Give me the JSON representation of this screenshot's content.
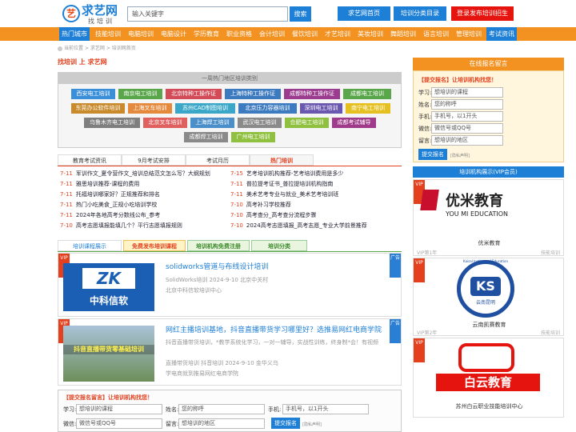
{
  "header": {
    "logo_char": "艺",
    "logo_name": "求艺网",
    "logo_sub": "找培训",
    "search_placeholder": "输入关键字",
    "search_label": "搜索",
    "btn_home": "求艺网首页",
    "btn_catalog": "培训分类目录",
    "btn_login": "登录发布培训招生"
  },
  "nav": [
    "热门城市",
    "技能培训",
    "电脑培训",
    "电脑设计",
    "学历教育",
    "职业资格",
    "会计培训",
    "餐饮培训",
    "才艺培训",
    "美妆培训",
    "舞蹈培训",
    "语言培训",
    "管理培训",
    "考试资讯"
  ],
  "breadcrumb": {
    "home": "当前位置",
    "sep1": ">",
    "link": "求艺网",
    "sep2": ">",
    "current": "培训网首页"
  },
  "main_title": "找培训 上 求艺网",
  "hot": {
    "heading": "一周热门地区培训类别",
    "tags": [
      "西安电工培训",
      "南京电工培训",
      "北京特种工操作证",
      "上海特种工操作证",
      "成都特种工操作证",
      "成都电工培训",
      "东莞办公软件培训",
      "上海叉车培训",
      "苏州CAD制图培训",
      "北京压力容器培训",
      "深圳电工培训",
      "南宁电工培训",
      "乌鲁木齐电工培训",
      "北京叉车培训",
      "上海焊工培训",
      "武汉电工培训",
      "合肥电工培训",
      "成都考试辅导",
      "成都焊工培训",
      "广州电工培训"
    ]
  },
  "tabs1": [
    "教育考试资讯",
    "9月考试安排",
    "考试月历",
    "热门培训"
  ],
  "news_left": [
    {
      "date": "7-11",
      "title": "军训作文_夏令营作文_培训总结范文怎么写？大纲规划"
    },
    {
      "date": "7-11",
      "title": "雅思培训推荐-课程的费用"
    },
    {
      "date": "7-11",
      "title": "托福培训哪家好？正规推荐和排名"
    },
    {
      "date": "7-11",
      "title": "热门小吃美食_正规小吃培训学校"
    },
    {
      "date": "7-11",
      "title": "2024年各地高考分数线公布_参考"
    },
    {
      "date": "7-10",
      "title": "高考志愿填报能填几个？平行志愿填报规则"
    }
  ],
  "news_right": [
    {
      "date": "7-15",
      "title": "艺考培训机构推荐-艺考培训费用是多少"
    },
    {
      "date": "7-11",
      "title": "普拉提考证书_普拉提培训机构指南"
    },
    {
      "date": "7-11",
      "title": "美术艺考专业与就业_美术艺考培训班"
    },
    {
      "date": "7-10",
      "title": "高考补习学校推荐"
    },
    {
      "date": "7-10",
      "title": "高考查分_高考查分流程步骤"
    },
    {
      "date": "7-10",
      "title": "2024高考志愿填报_高考志愿_专业大学前景推荐"
    }
  ],
  "tabs2": [
    "培训课程展示",
    "免费发布培训课程",
    "培训机构免费注册",
    "培训分类"
  ],
  "courses": [
    {
      "title": "solidworks管道与布线设计培训",
      "meta": "SolidWorks培训  2024-9-10  北京中关村",
      "org": "北京中科信软培训中心",
      "img_text": "ZK",
      "img_sub": "中科信软",
      "vip": "VIP",
      "ad": "广告"
    },
    {
      "title": "网红主播培训基地，抖音直播带货学习哪里好？选推易网红电商学院",
      "desc": "抖音直播带货培训，*教学系统化学习，一对一辅导，实战性训练，终身制*会！有视频",
      "meta": "直播带货培训  抖音培训  2024-9-10  金华义乌",
      "org": "学电商就到推易网红电商学院",
      "img_text": "抖音直播带货零基础培训",
      "vip": "VIP",
      "ad": "广告"
    }
  ],
  "form": {
    "title": "【提交报名留言】让培训机构找您！",
    "l_subject": "学习:",
    "p_subject": "想培训的课程",
    "l_name": "姓名:",
    "p_name": "您的称呼",
    "l_phone": "手机:",
    "p_phone": "手机号，以1开头",
    "l_wechat": "微信:",
    "p_wechat": "微信号或QQ号",
    "l_area": "留言:",
    "p_area": "想培训的地区",
    "submit": "提交报名",
    "note": "[隐私声明]"
  },
  "side": {
    "head1": "在线报名留言",
    "form_title": "【提交报名】让培训机构找您！",
    "head2": "培训机构展示(VIP会员)",
    "orgs": [
      {
        "logo": "优米教育",
        "logo_en": "YOU MI EDUCATION",
        "name": "优米教育",
        "vip": "VIP",
        "foot_l": "VIP第1年",
        "foot_r": "技能培训"
      },
      {
        "logo": "KS",
        "logo_ring": "Kaisal Institute of Education",
        "logo_sub": "云南昆明",
        "name": "云南凯赛教育",
        "vip": "VIP",
        "foot_l": "VIP第2年",
        "foot_r": "技能培训"
      },
      {
        "logo": "白云教育",
        "name": "苏州白云职业技能培训中心",
        "vip": "VIP"
      }
    ]
  },
  "colors": {
    "orange": "#f39221",
    "blue": "#1d7fd6",
    "red": "#e5401e"
  }
}
